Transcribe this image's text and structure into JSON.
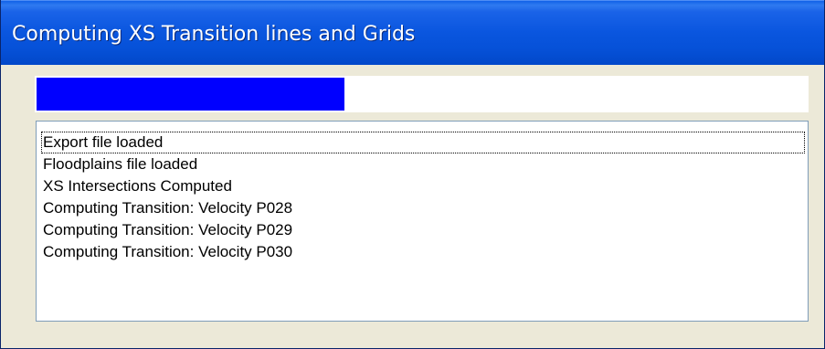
{
  "window": {
    "title": "Computing XS Transition lines and Grids"
  },
  "progress": {
    "fraction": 0.4,
    "color": "#0000ff"
  },
  "log": {
    "items": [
      "Export file loaded",
      "Floodplains file loaded",
      "XS Intersections Computed",
      "Computing Transition: Velocity P028",
      "Computing Transition: Velocity P029",
      "Computing Transition: Velocity P030"
    ],
    "focused_index": 0
  },
  "colors": {
    "titlebar": "#0a56df",
    "dialog_bg": "#ece9d8"
  }
}
